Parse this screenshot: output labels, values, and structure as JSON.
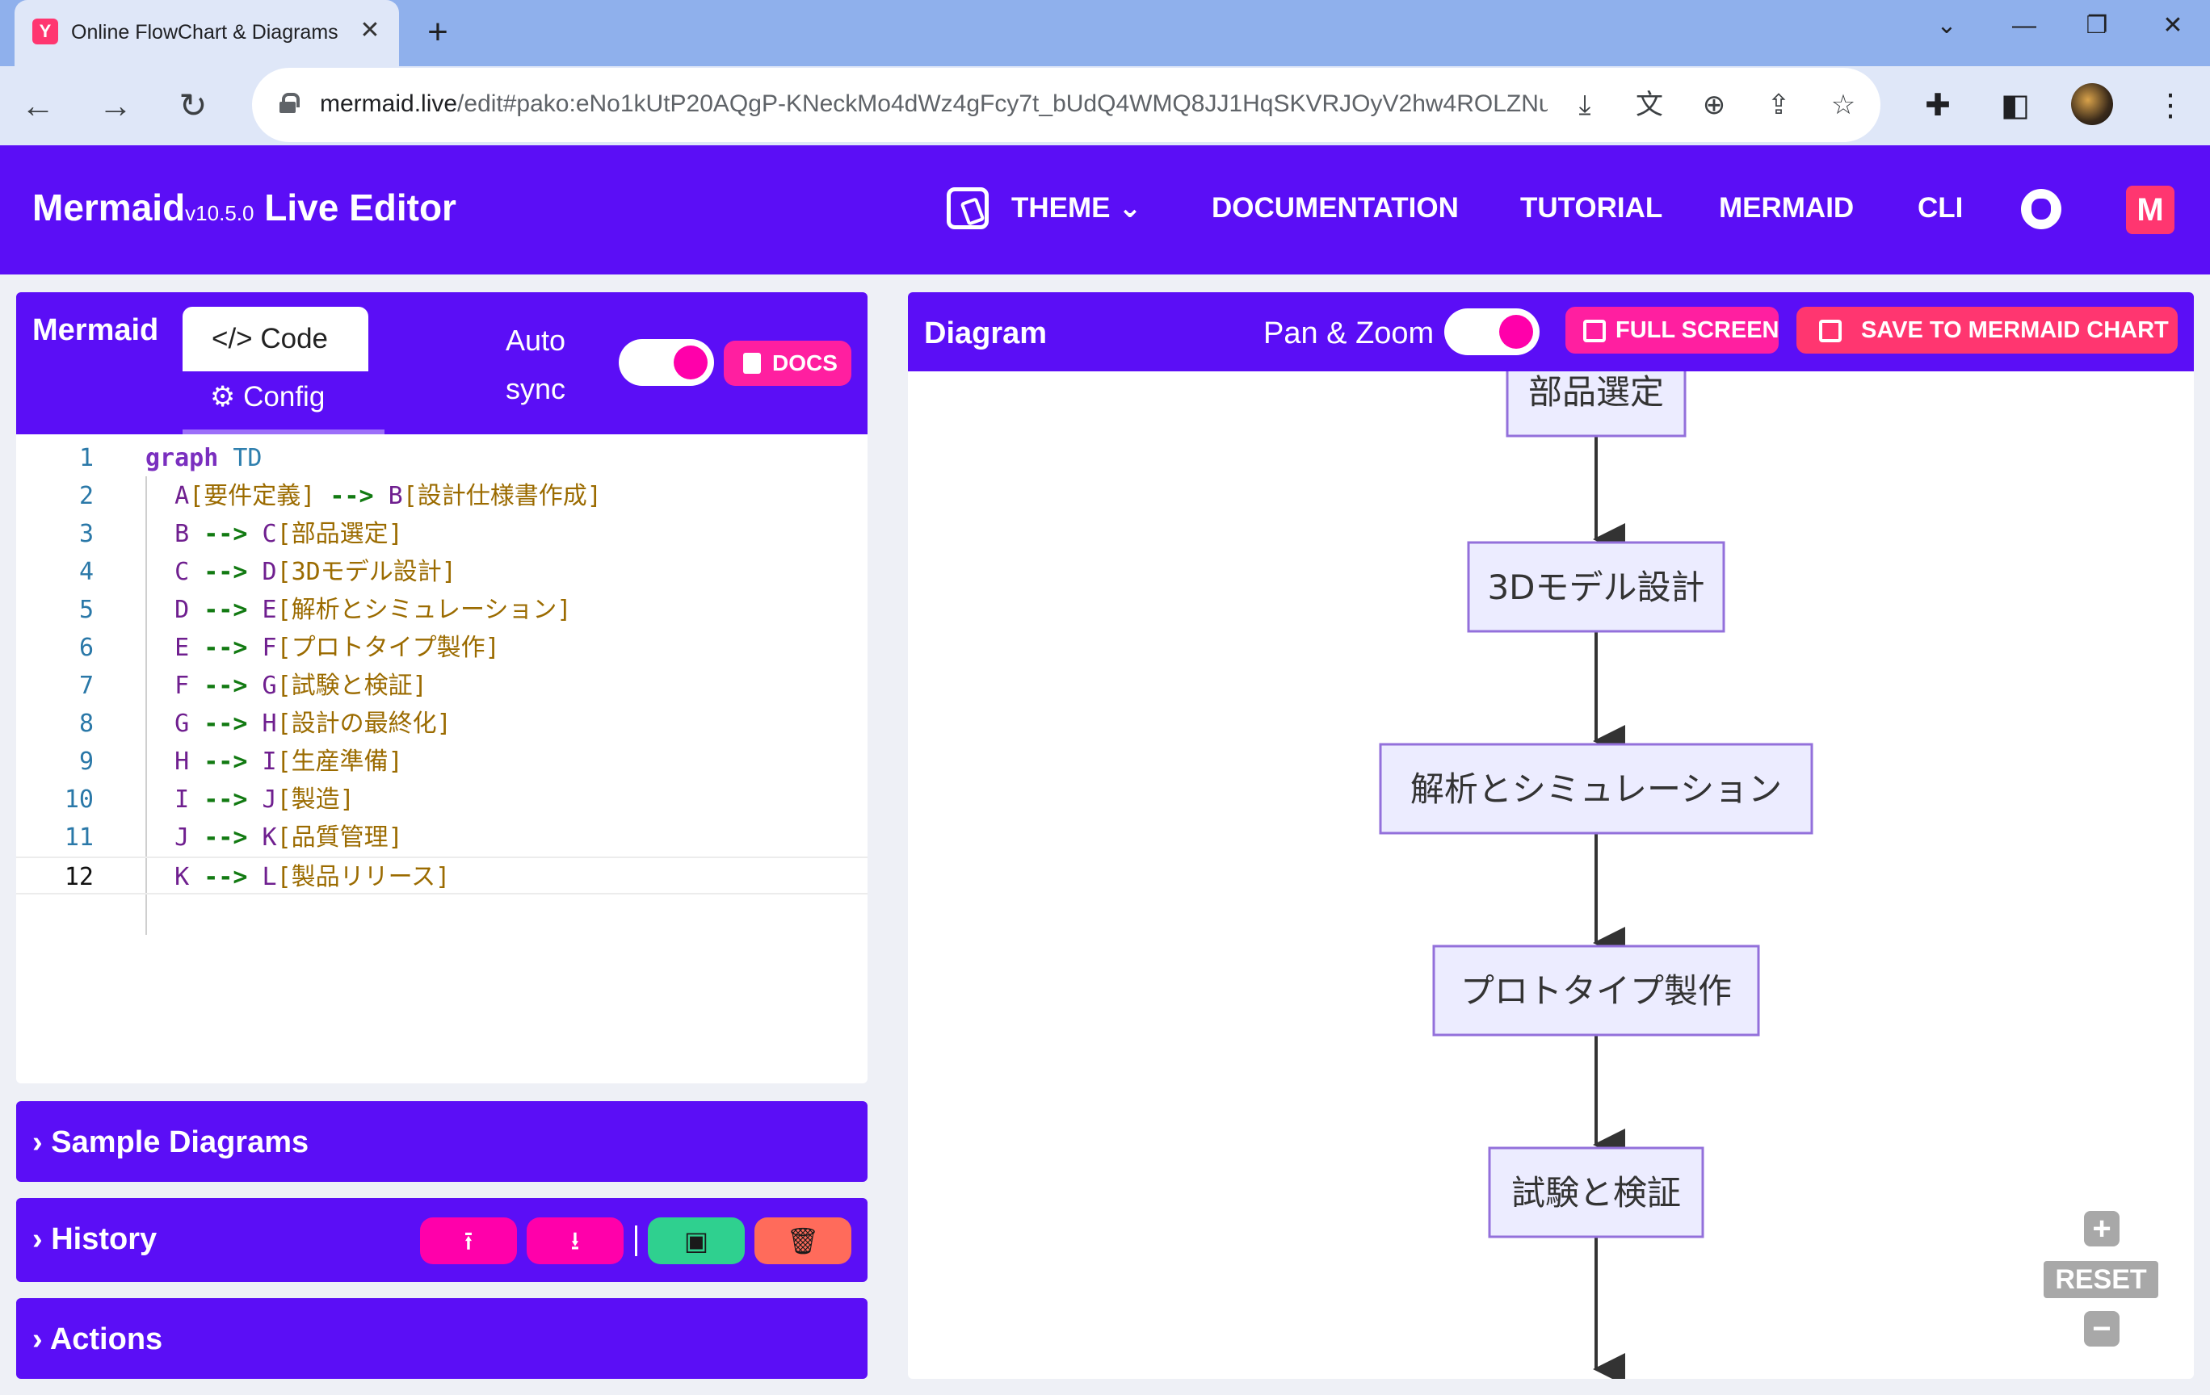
{
  "browser": {
    "tab_title": "Online FlowChart & Diagrams",
    "tab_close": "✕",
    "new_tab": "+",
    "url_host": "mermaid.live",
    "url_path": "/edit#pako:eNo1kUtP20AQgP-KNeckMo4dWz4gFcy7t_bUdQ4WMQ8JJ1HqSKVRJOyV2hw4ROLZNuI...",
    "controls": {
      "minimize": "—",
      "restore": "❐",
      "close": "✕",
      "chevron": "⌄"
    }
  },
  "app": {
    "brand": "Mermaid",
    "version": "v10.5.0",
    "brand_suffix": "Live Editor",
    "nav": {
      "theme": "THEME",
      "documentation": "DOCUMENTATION",
      "tutorial": "TUTORIAL",
      "mermaid": "MERMAID",
      "cli": "CLI"
    }
  },
  "editor": {
    "title": "Mermaid",
    "tab_code": "Code",
    "tab_config": "Config",
    "auto_sync_line1": "Auto",
    "auto_sync_line2": "sync",
    "auto_sync_on": true,
    "docs_label": "DOCS",
    "current_line": 12,
    "lines": [
      {
        "n": "1",
        "parts": [
          {
            "t": "graph",
            "c": "kw"
          },
          {
            "t": " TD",
            "c": "dir"
          }
        ]
      },
      {
        "n": "2",
        "parts": [
          {
            "t": "  A",
            "c": "node"
          },
          {
            "t": "[要件定義]",
            "c": "text"
          },
          {
            "t": " --> ",
            "c": "arrow"
          },
          {
            "t": "B",
            "c": "node"
          },
          {
            "t": "[設計仕様書作成]",
            "c": "text"
          }
        ]
      },
      {
        "n": "3",
        "parts": [
          {
            "t": "  B",
            "c": "node"
          },
          {
            "t": " --> ",
            "c": "arrow"
          },
          {
            "t": "C",
            "c": "node"
          },
          {
            "t": "[部品選定]",
            "c": "text"
          }
        ]
      },
      {
        "n": "4",
        "parts": [
          {
            "t": "  C",
            "c": "node"
          },
          {
            "t": " --> ",
            "c": "arrow"
          },
          {
            "t": "D",
            "c": "node"
          },
          {
            "t": "[3Dモデル設計]",
            "c": "text"
          }
        ]
      },
      {
        "n": "5",
        "parts": [
          {
            "t": "  D",
            "c": "node"
          },
          {
            "t": " --> ",
            "c": "arrow"
          },
          {
            "t": "E",
            "c": "node"
          },
          {
            "t": "[解析とシミュレーション]",
            "c": "text"
          }
        ]
      },
      {
        "n": "6",
        "parts": [
          {
            "t": "  E",
            "c": "node"
          },
          {
            "t": " --> ",
            "c": "arrow"
          },
          {
            "t": "F",
            "c": "node"
          },
          {
            "t": "[プロトタイプ製作]",
            "c": "text"
          }
        ]
      },
      {
        "n": "7",
        "parts": [
          {
            "t": "  F",
            "c": "node"
          },
          {
            "t": " --> ",
            "c": "arrow"
          },
          {
            "t": "G",
            "c": "node"
          },
          {
            "t": "[試験と検証]",
            "c": "text"
          }
        ]
      },
      {
        "n": "8",
        "parts": [
          {
            "t": "  G",
            "c": "node"
          },
          {
            "t": " --> ",
            "c": "arrow"
          },
          {
            "t": "H",
            "c": "node"
          },
          {
            "t": "[設計の最終化]",
            "c": "text"
          }
        ]
      },
      {
        "n": "9",
        "parts": [
          {
            "t": "  H",
            "c": "node"
          },
          {
            "t": " --> ",
            "c": "arrow"
          },
          {
            "t": "I",
            "c": "node"
          },
          {
            "t": "[生産準備]",
            "c": "text"
          }
        ]
      },
      {
        "n": "10",
        "parts": [
          {
            "t": "  I",
            "c": "node"
          },
          {
            "t": " --> ",
            "c": "arrow"
          },
          {
            "t": "J",
            "c": "node"
          },
          {
            "t": "[製造]",
            "c": "text"
          }
        ]
      },
      {
        "n": "11",
        "parts": [
          {
            "t": "  J",
            "c": "node"
          },
          {
            "t": " --> ",
            "c": "arrow"
          },
          {
            "t": "K",
            "c": "node"
          },
          {
            "t": "[品質管理]",
            "c": "text"
          }
        ]
      },
      {
        "n": "12",
        "parts": [
          {
            "t": "  K",
            "c": "node"
          },
          {
            "t": " --> ",
            "c": "arrow"
          },
          {
            "t": "L",
            "c": "node"
          },
          {
            "t": "[製品リリース]",
            "c": "text"
          }
        ]
      }
    ]
  },
  "accordions": {
    "samples": "Sample Diagrams",
    "history": "History",
    "actions": "Actions"
  },
  "history_buttons": {
    "upload": "⭱",
    "download": "⭳",
    "save": "▣",
    "delete": "🗑"
  },
  "diagram": {
    "title": "Diagram",
    "pan_zoom_label": "Pan & Zoom",
    "pan_zoom_on": true,
    "full_screen_label": "FULL SCREEN",
    "save_chart_label": "SAVE TO MERMAID CHART",
    "zoom_in": "+",
    "reset": "RESET",
    "zoom_out": "−",
    "nodes": [
      "部品選定",
      "3Dモデル設計",
      "解析とシミュレーション",
      "プロトタイプ製作",
      "試験と検証"
    ],
    "node_fill": "#ececff",
    "node_stroke": "#9370db"
  },
  "colors": {
    "brand": "#5b0ef6",
    "pink": "#ff1fa0",
    "green": "#2fd08f",
    "red": "#ff6b5b"
  }
}
